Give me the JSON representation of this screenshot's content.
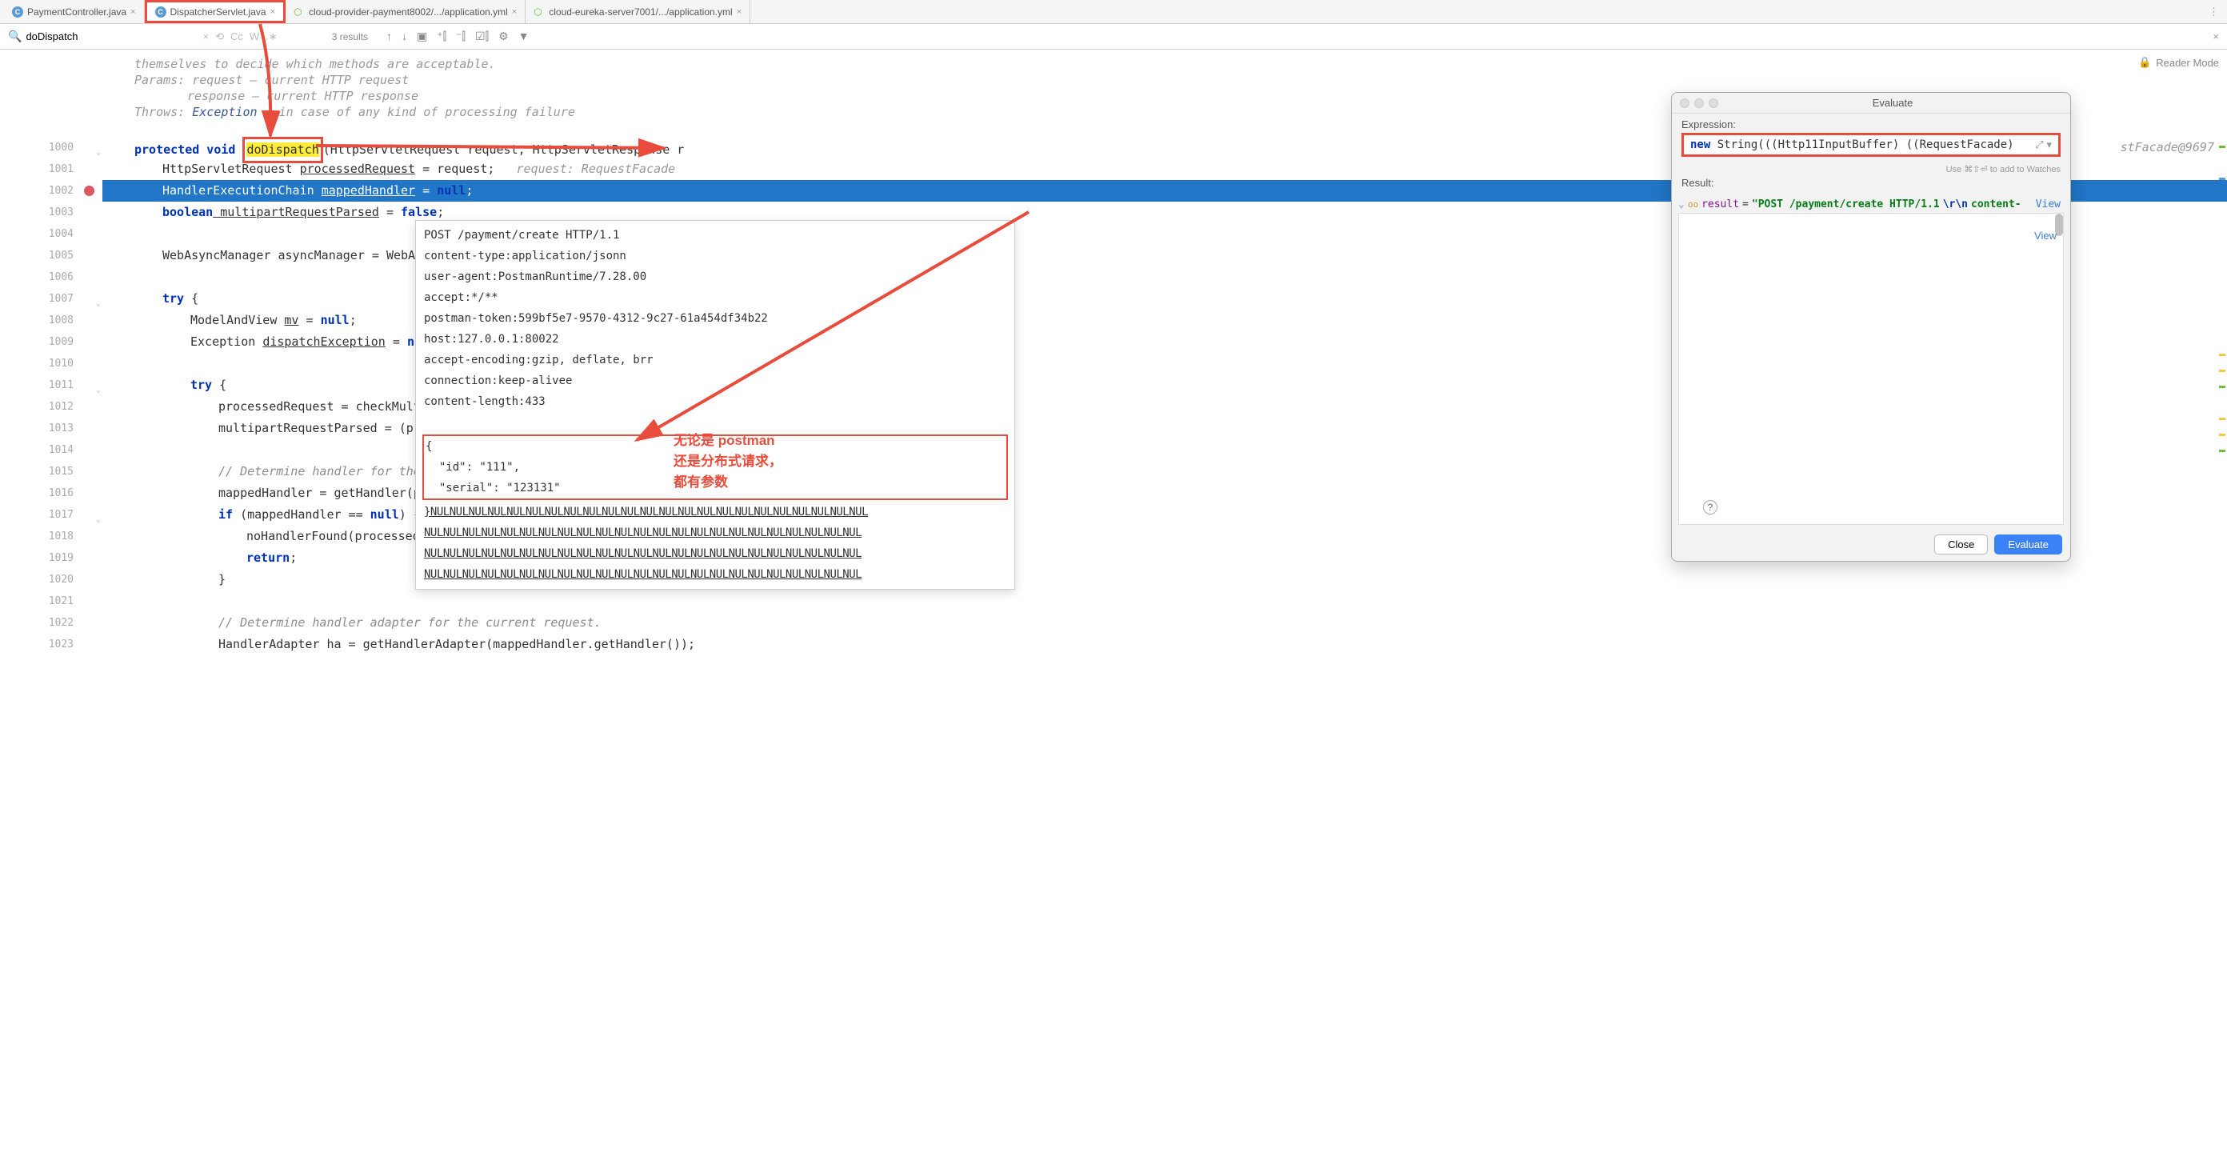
{
  "tabs": [
    {
      "icon": "C",
      "label": "PaymentController.java",
      "active": false,
      "highlighted": false
    },
    {
      "icon": "C",
      "label": "DispatcherServlet.java",
      "active": true,
      "highlighted": true
    },
    {
      "icon": "yml",
      "label": "cloud-provider-payment8002/.../application.yml",
      "active": false,
      "highlighted": false
    },
    {
      "icon": "yml",
      "label": "cloud-eureka-server7001/.../application.yml",
      "active": false,
      "highlighted": false
    }
  ],
  "search": {
    "query": "doDispatch",
    "results": "3 results"
  },
  "reader_label": "Reader Mode",
  "doc": {
    "line1": "themselves to decide which methods are acceptable.",
    "params_label": "Params:",
    "params1": "request – current HTTP request",
    "params2": "response – current HTTP response",
    "throws_label": "Throws:",
    "throws_link": "Exception",
    "throws_text": " – in case of any kind of processing failure"
  },
  "gutter_start": 1000,
  "gutter_end": 1023,
  "breakpoint_line": 1002,
  "code": {
    "method_sig_pre": "protected void ",
    "method_name": "doDispatch",
    "method_sig_post": "(HttpServletRequest request, HttpServletResponse r",
    "inline_right": "stFacade@9697",
    "l1": "HttpServletRequest processedRequest = request;",
    "l1_inline": "   request: RequestFacade",
    "l2": "HandlerExecutionChain mappedHandler = null;",
    "l3_a": "boolean",
    "l3_b": " multipartRequestParsed",
    "l3_c": " = ",
    "l3_d": "false",
    "l3_e": ";",
    "l5": "WebAsyncManager asyncManager = WebAsy",
    "l7": "try {",
    "l8_a": "ModelAndView ",
    "l8_b": "mv",
    "l8_c": " = ",
    "l8_d": "null",
    "l8_e": ";",
    "l9_a": "Exception ",
    "l9_b": "dispatchException",
    "l9_c": " = ",
    "l9_d": "nul",
    "l11": "try {",
    "l12": "processedRequest = checkMulti",
    "l13": "multipartRequestParsed = (pro",
    "l15": "// Determine handler for the ",
    "l16": "mappedHandler = getHandler(pr",
    "l17_a": "if",
    "l17_b": " (mappedHandler == ",
    "l17_c": "null",
    "l17_d": ") {",
    "l18": "noHandlerFound(processedR",
    "l19": "return;",
    "l20": "}",
    "l22": "// Determine handler adapter for the current request.",
    "l23": "HandlerAdapter ha = getHandlerAdapter(mappedHandler.getHandler());"
  },
  "tooltip": {
    "l1": "POST /payment/create HTTP/1.1",
    "l2": "content-type:application/jsonn",
    "l3": "user-agent:PostmanRuntime/7.28.00",
    "l4": "accept:*/**",
    "l5": "postman-token:599bf5e7-9570-4312-9c27-61a454df34b22",
    "l6": "host:127.0.0.1:80022",
    "l7": "accept-encoding:gzip, deflate, brr",
    "l8": "connection:keep-alivee",
    "l9": "content-length:433",
    "json_open": "{",
    "json_l1": "  \"id\": \"111\",",
    "json_l2": "  \"serial\": \"123131\"",
    "nul": "}NULNULNULNULNULNULNULNULNULNULNULNULNULNULNULNULNULNULNULNULNULNULNUL",
    "nul2": "NULNULNULNULNULNULNULNULNULNULNULNULNULNULNULNULNULNULNULNULNULNULNUL",
    "nul3": "NULNULNULNULNULNULNULNULNULNULNULNULNULNULNULNULNULNULNULNULNULNULNUL",
    "nul4": "NULNULNULNULNULNULNULNULNULNULNULNULNULNULNULNULNULNULNULNULNULNULNUL"
  },
  "evaluate": {
    "title": "Evaluate",
    "expression_label": "Expression:",
    "expression_text_pre": "new ",
    "expression_text": "String(((Http11InputBuffer) ((RequestFacade)",
    "hint": "Use ⌘⇧⏎ to add to Watches",
    "result_label": "Result:",
    "result_key": "result",
    "result_eq": " = ",
    "result_val_a": "\"POST /payment/create HTTP/1.1",
    "result_esc1": "\\r\\n",
    "result_val_b": "content-",
    "view_label": "View",
    "close_label": "Close",
    "evaluate_label": "Evaluate"
  },
  "annotation": {
    "line1": "无论是 postman",
    "line2": "还是分布式请求，",
    "line3": "都有参数"
  }
}
